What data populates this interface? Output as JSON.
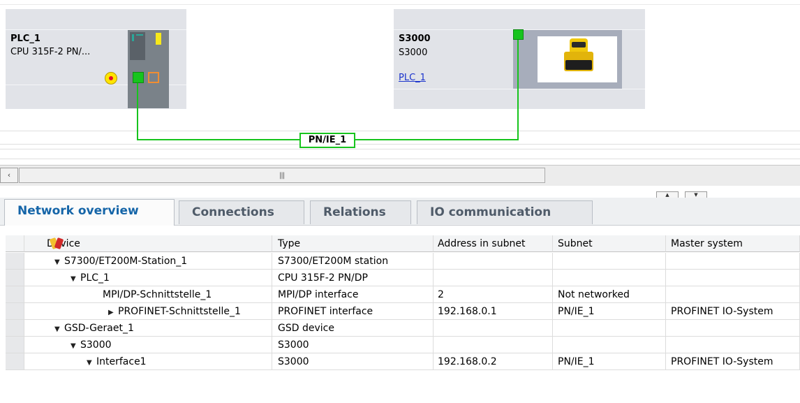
{
  "network_view": {
    "plc_device": {
      "name": "PLC_1",
      "type": "CPU 315F-2 PN/..."
    },
    "s3000_device": {
      "name": "S3000",
      "type": "S3000",
      "master_link": "PLC_1"
    },
    "network_label": "PN/IE_1",
    "colors": {
      "network_line": "#17c41d",
      "device_card": "#e1e3e8"
    }
  },
  "scrollbar": {
    "left_button": "‹",
    "grip": "|||"
  },
  "splitter": {
    "up": "▲",
    "down": "▼"
  },
  "tabs": [
    {
      "label": "Network overview",
      "active": true
    },
    {
      "label": "Connections",
      "active": false
    },
    {
      "label": "Relations",
      "active": false
    },
    {
      "label": "IO communication",
      "active": false
    }
  ],
  "table": {
    "columns": [
      "Device",
      "Type",
      "Address in subnet",
      "Subnet",
      "Master system"
    ],
    "rows": [
      {
        "device": "S7300/ET200M-Station_1",
        "expander": "▼",
        "type": "S7300/ET200M station",
        "address": "",
        "subnet": "",
        "master": ""
      },
      {
        "device": "PLC_1",
        "expander": "▼",
        "type": "CPU 315F-2 PN/DP",
        "address": "",
        "subnet": "",
        "master": ""
      },
      {
        "device": "MPI/DP-Schnittstelle_1",
        "expander": "",
        "type": "MPI/DP interface",
        "address": "2",
        "subnet": "Not networked",
        "master": ""
      },
      {
        "device": "PROFINET-Schnittstelle_1",
        "expander": "▶",
        "type": "PROFINET interface",
        "address": "192.168.0.1",
        "subnet": "PN/IE_1",
        "master": "PROFINET IO-System"
      },
      {
        "device": "GSD-Geraet_1",
        "expander": "▼",
        "type": "GSD device",
        "address": "",
        "subnet": "",
        "master": ""
      },
      {
        "device": "S3000",
        "expander": "▼",
        "type": "S3000",
        "address": "",
        "subnet": "",
        "master": ""
      },
      {
        "device": "Interface1",
        "expander": "▼",
        "type": "S3000",
        "address": "192.168.0.2",
        "subnet": "PN/IE_1",
        "master": "PROFINET IO-System"
      }
    ]
  }
}
